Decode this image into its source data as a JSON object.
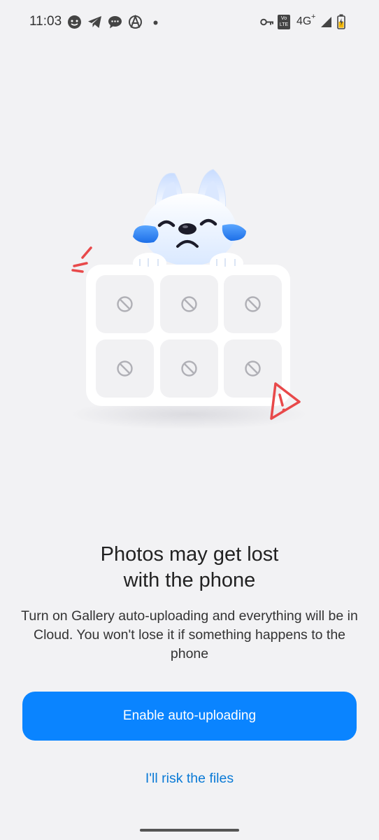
{
  "status_bar": {
    "time": "11:03",
    "notification_icons": [
      "chat-bubble-smile-icon",
      "telegram-icon",
      "message-bubble-icon",
      "anarchy-icon",
      "dot-icon"
    ],
    "right": {
      "key_icon": "vpn-key-icon",
      "volte_label_top": "Vo",
      "volte_label_bottom": "LTE",
      "network_label": "4G",
      "network_plus": "+",
      "signal_icon": "signal-icon",
      "battery_icon": "battery-charging-icon"
    }
  },
  "illustration": {
    "mascot": "crying-dog-mascot",
    "grid_cells": 6,
    "cell_icon": "no-entry-icon",
    "warning_icon": "warning-triangle-icon",
    "accent_color": "#e8494a"
  },
  "content": {
    "title_line1": "Photos may get lost",
    "title_line2": "with the phone",
    "description": "Turn on Gallery auto-uploading and everything will be in Cloud. You won't lose it if something happens to the phone"
  },
  "actions": {
    "enable_label": "Enable auto-uploading",
    "risk_label": "I'll risk the files"
  },
  "colors": {
    "background": "#f2f2f4",
    "primary": "#0a84ff",
    "link": "#0a7ad6"
  }
}
